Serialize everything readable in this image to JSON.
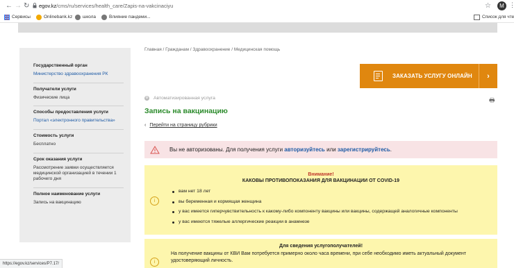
{
  "browser": {
    "url_host": "egov.kz",
    "url_path": "/cms/ru/services/health_care/Zapis-na-vakcinaciyu",
    "profile_initial": "M",
    "bookmarks": [
      "Сервисы",
      "Onlinebank.kz",
      "школа",
      "Влияние пандеми..."
    ],
    "reading_list": "Список для чтени"
  },
  "sidebar": {
    "items": [
      {
        "heading": "Государственный орган",
        "value": "Министерство здравоохранения РК",
        "is_link": true
      },
      {
        "heading": "Получатели услуги",
        "value": "Физические лица",
        "is_link": false
      },
      {
        "heading": "Способы предоставления услуги",
        "value": "Портал «электронного правительства»",
        "is_link": true
      },
      {
        "heading": "Стоимость услуги",
        "value": "Бесплатно",
        "is_link": false
      },
      {
        "heading": "Срок оказания услуги",
        "value": "Рассмотрение заявки осуществляется медицинской организацией в течении 1 рабочего дня",
        "is_link": false
      },
      {
        "heading": "Полное наименование услуги",
        "value": "Запись на вакцинацию",
        "is_link": false
      }
    ]
  },
  "breadcrumb": "Главная / Гражданам / Здравоохранение / Медицинская помощь",
  "order_button": "ЗАКАЗАТЬ УСЛУГУ ОНЛАЙН",
  "service_type": "Автоматизированная услуга",
  "page_title": "Запись на вакцинацию",
  "back_link": "Перейти на страницу рубрики",
  "alert": {
    "prefix": "Вы не авторизованы. Для получения услуги",
    "login": "авторизуйтесь",
    "or": "или",
    "register": "зарегистрируйтесь",
    "suffix": "."
  },
  "contraindications": {
    "attention": "Внимание!",
    "title": "КАКОВЫ ПРОТИВОПОКАЗАНИЯ ДЛЯ ВАКЦИНАЦИИ ОТ COVID-19",
    "items": [
      "вам нет 18 лет",
      "вы беременная и кормящая женщина",
      "у вас имеется гиперчувствительность к какому-либо компоненту вакцины или вакцины, содержащей аналогичные компоненты",
      "у вас имеются тяжелые аллергические реакции в анамнезе"
    ]
  },
  "info_box": {
    "title": "Для сведения услугополучателей!",
    "text": "На получение вакцины от КВИ Вам потребуется примерно около часа времени, при себе необходимо иметь актуальный документ удостоверяющий личность."
  },
  "status_url": "https://egov.kz/services/P7.17/",
  "colors": {
    "accent": "#e0870f",
    "title_green": "#2a8a2a",
    "link": "#1d5aa5",
    "alert_bg": "#f8e3e5",
    "info_bg": "#fdf6ad"
  }
}
